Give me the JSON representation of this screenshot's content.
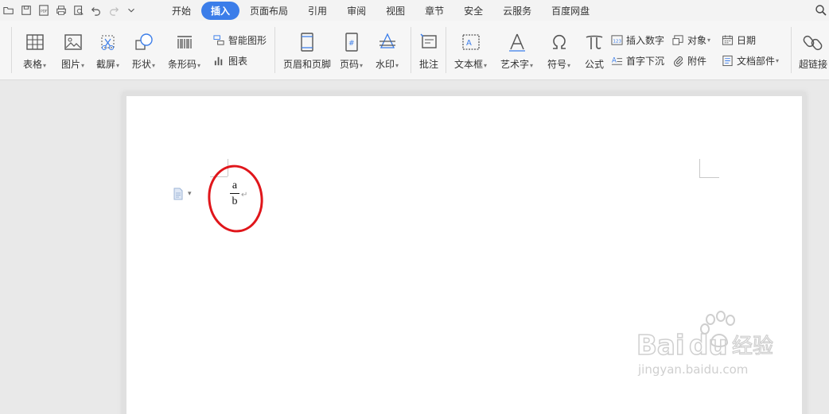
{
  "menu": {
    "tabs": [
      {
        "label": "开始",
        "active": false
      },
      {
        "label": "插入",
        "active": true
      },
      {
        "label": "页面布局",
        "active": false
      },
      {
        "label": "引用",
        "active": false
      },
      {
        "label": "审阅",
        "active": false
      },
      {
        "label": "视图",
        "active": false
      },
      {
        "label": "章节",
        "active": false
      },
      {
        "label": "安全",
        "active": false
      },
      {
        "label": "云服务",
        "active": false
      },
      {
        "label": "百度网盘",
        "active": false
      }
    ],
    "accent_color": "#3b7de9"
  },
  "ribbon": {
    "table": "表格",
    "picture": "图片",
    "screenshot": "截屏",
    "shape": "形状",
    "barcode": "条形码",
    "smart_art": "智能图形",
    "chart": "图表",
    "header_footer": "页眉和页脚",
    "page_number": "页码",
    "watermark": "水印",
    "comment": "批注",
    "textbox": "文本框",
    "wordart": "艺术字",
    "symbol": "符号",
    "equation": "公式",
    "insert_number": "插入数字",
    "drop_cap": "首字下沉",
    "object": "对象",
    "attachment": "附件",
    "date": "日期",
    "doc_parts": "文档部件",
    "hyperlink": "超链接"
  },
  "document": {
    "numerator": "a",
    "denominator": "b",
    "annotation_color": "#e0161b"
  },
  "watermark": {
    "brand": "Baidu经验",
    "url": "jingyan.baidu.com"
  }
}
